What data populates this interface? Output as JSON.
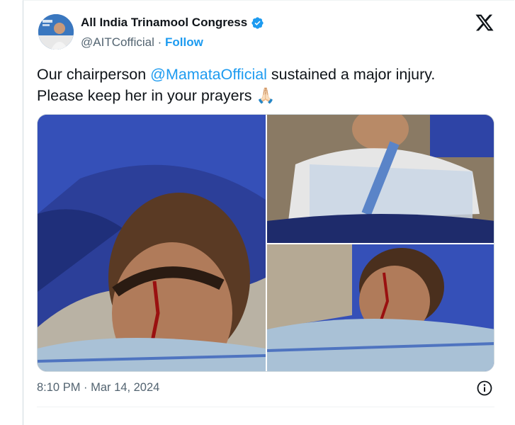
{
  "tweet": {
    "author_name": "All India Trinamool Congress",
    "handle": "@AITCofficial",
    "separator": "·",
    "follow_label": "Follow",
    "text_prefix": "Our chairperson ",
    "mention": "@MamataOfficial",
    "text_suffix": " sustained a major injury.",
    "text_line2": "Please keep her in your prayers 🙏🏻",
    "timestamp": "8:10 PM · Mar 14, 2024"
  },
  "colors": {
    "accent": "#1d9bf0",
    "text": "#0f1419",
    "muted": "#536471"
  },
  "icons": [
    "verified-badge-icon",
    "x-logo-icon",
    "info-icon"
  ]
}
